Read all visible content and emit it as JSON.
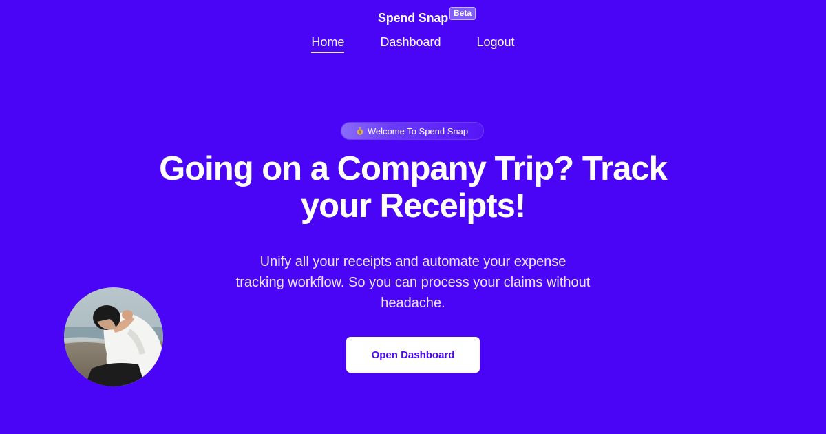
{
  "header": {
    "brand": "Spend Snap",
    "badge": "Beta"
  },
  "nav": {
    "items": [
      {
        "label": "Home",
        "active": true
      },
      {
        "label": "Dashboard",
        "active": false
      },
      {
        "label": "Logout",
        "active": false
      }
    ]
  },
  "hero": {
    "pill_icon": "money-bag-icon",
    "pill_text": "Welcome To Spend Snap",
    "headline_line1": "Going on a Company Trip? Track",
    "headline_line2": "your Receipts!",
    "subtext": "Unify all your receipts and automate your expense tracking workflow. So you can process your claims without headache.",
    "cta_label": "Open Dashboard"
  },
  "colors": {
    "background": "#4a05f7",
    "accent_text": "#4a05f7",
    "button_bg": "#ffffff",
    "badge_bg": "#7d5cf8"
  }
}
